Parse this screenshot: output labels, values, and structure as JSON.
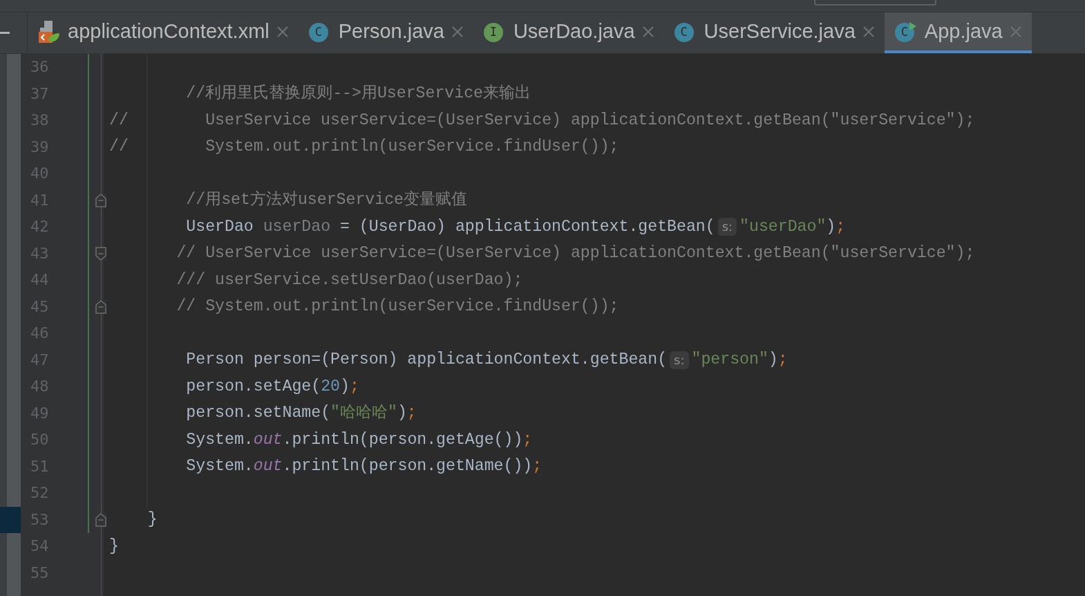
{
  "tabs": [
    {
      "label": "applicationContext.xml",
      "kind": "xml",
      "selected": false
    },
    {
      "label": "Person.java",
      "kind": "class",
      "icon_letter": "C",
      "selected": false
    },
    {
      "label": "UserDao.java",
      "kind": "interface",
      "icon_letter": "I",
      "selected": false
    },
    {
      "label": "UserService.java",
      "kind": "class",
      "icon_letter": "C",
      "selected": false
    },
    {
      "label": "App.java",
      "kind": "runnable",
      "icon_letter": "C",
      "selected": true
    }
  ],
  "editor": {
    "lines": [
      {
        "number": "36"
      },
      {
        "number": "37",
        "tokens": [
          {
            "text": "        //利用里氏替换原则-->用UserService来输出",
            "kind": "comment"
          }
        ]
      },
      {
        "number": "38",
        "tokens": [
          {
            "text": "//        UserService userService=(UserService) applicationContext.getBean(\"userService\");",
            "kind": "comment"
          }
        ]
      },
      {
        "number": "39",
        "tokens": [
          {
            "text": "//        System.out.println(userService.findUser());",
            "kind": "comment"
          }
        ]
      },
      {
        "number": "40"
      },
      {
        "number": "41",
        "fold_end": true,
        "tokens": [
          {
            "text": "        //用set方法对userService变量赋值",
            "kind": "comment"
          }
        ]
      },
      {
        "number": "42",
        "tokens": [
          {
            "text": "        UserDao",
            "kind": "plain"
          },
          {
            "text": " userDao",
            "kind": "unused"
          },
          {
            "text": " = (UserDao) applicationContext.getBean(",
            "kind": "plain"
          },
          {
            "text": "s:",
            "kind": "hint"
          },
          {
            "text": "\"userDao\"",
            "kind": "string"
          },
          {
            "text": ")",
            "kind": "plain"
          },
          {
            "text": ";",
            "kind": "semicolon"
          }
        ]
      },
      {
        "number": "43",
        "fold_start": true,
        "tokens": [
          {
            "text": "       // UserService userService=(UserService) applicationContext.getBean(\"userService\");",
            "kind": "comment"
          }
        ]
      },
      {
        "number": "44",
        "tokens": [
          {
            "text": "       /// userService.setUserDao(userDao);",
            "kind": "comment"
          }
        ]
      },
      {
        "number": "45",
        "fold_end": true,
        "tokens": [
          {
            "text": "       // System.out.println(userService.findUser());",
            "kind": "comment"
          }
        ]
      },
      {
        "number": "46"
      },
      {
        "number": "47",
        "tokens": [
          {
            "text": "        Person person=(Person) applicationContext.getBean(",
            "kind": "plain"
          },
          {
            "text": "s:",
            "kind": "hint"
          },
          {
            "text": "\"person\"",
            "kind": "string"
          },
          {
            "text": ")",
            "kind": "plain"
          },
          {
            "text": ";",
            "kind": "semicolon"
          }
        ]
      },
      {
        "number": "48",
        "tokens": [
          {
            "text": "        person.setAge(",
            "kind": "plain"
          },
          {
            "text": "20",
            "kind": "number"
          },
          {
            "text": ")",
            "kind": "plain"
          },
          {
            "text": ";",
            "kind": "semicolon"
          }
        ]
      },
      {
        "number": "49",
        "tokens": [
          {
            "text": "        person.setName(",
            "kind": "plain"
          },
          {
            "text": "\"哈哈哈\"",
            "kind": "string"
          },
          {
            "text": ")",
            "kind": "plain"
          },
          {
            "text": ";",
            "kind": "semicolon"
          }
        ]
      },
      {
        "number": "50",
        "tokens": [
          {
            "text": "        System.",
            "kind": "plain"
          },
          {
            "text": "out",
            "kind": "field"
          },
          {
            "text": ".println(person.getAge())",
            "kind": "plain"
          },
          {
            "text": ";",
            "kind": "semicolon"
          }
        ]
      },
      {
        "number": "51",
        "tokens": [
          {
            "text": "        System.",
            "kind": "plain"
          },
          {
            "text": "out",
            "kind": "field"
          },
          {
            "text": ".println(person.getName())",
            "kind": "plain"
          },
          {
            "text": ";",
            "kind": "semicolon"
          }
        ]
      },
      {
        "number": "52"
      },
      {
        "number": "53",
        "current": true,
        "fold_end": true,
        "tokens": [
          {
            "text": "    }",
            "kind": "plain"
          }
        ]
      },
      {
        "number": "54",
        "tokens": [
          {
            "text": "}",
            "kind": "plain"
          }
        ]
      },
      {
        "number": "55"
      }
    ]
  }
}
